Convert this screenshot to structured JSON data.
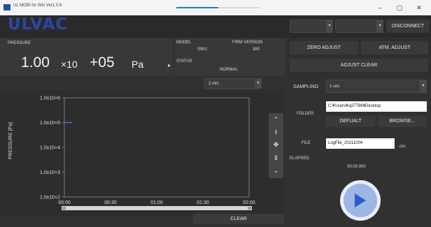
{
  "window": {
    "title": "UL MOBI for Win Ver1.0.6",
    "progress_fraction": 0.5,
    "min_glyph": "–",
    "max_glyph": "▢",
    "close_glyph": "✕"
  },
  "header": {
    "logo": "ULVAC",
    "disconnect_label": "DISCONNECT",
    "zero_adjust_label": "ZERO ADJUST",
    "atm_adjust_label": "ATM. ADJUST",
    "adjust_clear_label": "ADJUST CLEAR"
  },
  "pressure": {
    "label": "PRESSURE",
    "mantissa": "1.00",
    "times": "×10",
    "exponent": "+05",
    "unit": "Pa"
  },
  "device": {
    "model_label": "MODEL",
    "model_value": "SWU",
    "firm_label": "FIRM VERSION",
    "firm_value": "380",
    "status_label": "STATUS",
    "status_value": "NORMAL"
  },
  "chart_controls": {
    "time_span": "2 min",
    "clear_label": "CLEAR"
  },
  "chart_data": {
    "type": "line",
    "ylabel": "PRESSURE [Pa]",
    "yscale": "log",
    "ylim": [
      100,
      1000000
    ],
    "yticks": [
      "1.0x10+6",
      "1.0x10+5",
      "1.0x10+4",
      "1.0x10+3",
      "1.0x10+2"
    ],
    "xticks": [
      "00:00",
      "00:30",
      "01:00",
      "01:30",
      "02:00"
    ],
    "series": [
      {
        "color": "#3c8cff",
        "x": [
          "00:00",
          "00:05"
        ],
        "y": [
          100000,
          100000
        ]
      }
    ]
  },
  "settings": {
    "sampling_label": "SAMPLING",
    "sampling_value": "1 sec",
    "folder_label": "FOLDER",
    "folder_value": "C:¥Users¥uj27786¥Desktop",
    "default_label": "DEFUALT",
    "browse_label": "BROWSE...",
    "file_label": "FILE",
    "file_value": "LogFile_20211004",
    "file_ext": ".csv",
    "elapsed_label": "ELAPSED",
    "elapsed_value": "00:00.000"
  },
  "icons": {
    "up": "⌃",
    "zoom_in": "⤈",
    "pan": "✥",
    "zoom_out": "⇕",
    "down": "⌄",
    "dd_arrow": "▾"
  }
}
